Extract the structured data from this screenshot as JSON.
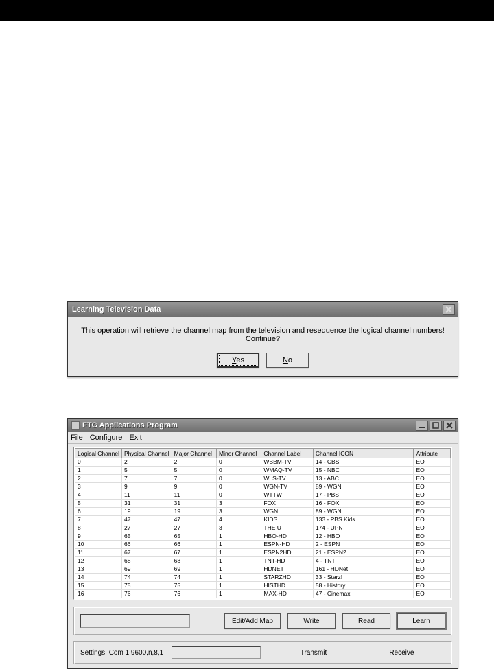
{
  "dialog": {
    "title": "Learning Television Data",
    "message": "This operation will retrieve the channel map from the television and resequence the logical channel numbers! Continue?",
    "yes": "Yes",
    "no": "No"
  },
  "mainWindow": {
    "title": "FTG Applications Program",
    "menu": {
      "file": "File",
      "configure": "Configure",
      "exit": "Exit"
    },
    "columns": {
      "logical": "Logical Channel",
      "physical": "Physical Channel",
      "major": "Major Channel",
      "minor": "Minor Channel",
      "label": "Channel Label",
      "icon": "Channel ICON",
      "attr": "Attribute"
    },
    "rows": [
      {
        "logical": "0",
        "physical": "2",
        "major": "2",
        "minor": "0",
        "label": "WBBM-TV",
        "icon": "14 - CBS",
        "attr": "EO"
      },
      {
        "logical": "1",
        "physical": "5",
        "major": "5",
        "minor": "0",
        "label": "WMAQ-TV",
        "icon": "15 - NBC",
        "attr": "EO"
      },
      {
        "logical": "2",
        "physical": "7",
        "major": "7",
        "minor": "0",
        "label": "WLS-TV",
        "icon": "13 - ABC",
        "attr": "EO"
      },
      {
        "logical": "3",
        "physical": "9",
        "major": "9",
        "minor": "0",
        "label": "WGN-TV",
        "icon": "89 - WGN",
        "attr": "EO"
      },
      {
        "logical": "4",
        "physical": "11",
        "major": "11",
        "minor": "0",
        "label": "WTTW",
        "icon": "17 - PBS",
        "attr": "EO"
      },
      {
        "logical": "5",
        "physical": "31",
        "major": "31",
        "minor": "3",
        "label": "FOX",
        "icon": "16 - FOX",
        "attr": "EO"
      },
      {
        "logical": "6",
        "physical": "19",
        "major": "19",
        "minor": "3",
        "label": "WGN",
        "icon": "89 - WGN",
        "attr": "EO"
      },
      {
        "logical": "7",
        "physical": "47",
        "major": "47",
        "minor": "4",
        "label": "KIDS",
        "icon": "133 - PBS Kids",
        "attr": "EO"
      },
      {
        "logical": "8",
        "physical": "27",
        "major": "27",
        "minor": "3",
        "label": "THE U",
        "icon": "174 - UPN",
        "attr": "EO"
      },
      {
        "logical": "9",
        "physical": "65",
        "major": "65",
        "minor": "1",
        "label": "HBO-HD",
        "icon": "12 - HBO",
        "attr": "EO"
      },
      {
        "logical": "10",
        "physical": "66",
        "major": "66",
        "minor": "1",
        "label": "ESPN-HD",
        "icon": "2 - ESPN",
        "attr": "EO"
      },
      {
        "logical": "11",
        "physical": "67",
        "major": "67",
        "minor": "1",
        "label": "ESPN2HD",
        "icon": "21 - ESPN2",
        "attr": "EO"
      },
      {
        "logical": "12",
        "physical": "68",
        "major": "68",
        "minor": "1",
        "label": "TNT-HD",
        "icon": "4 - TNT",
        "attr": "EO"
      },
      {
        "logical": "13",
        "physical": "69",
        "major": "69",
        "minor": "1",
        "label": "HDNET",
        "icon": "161 - HDNet",
        "attr": "EO"
      },
      {
        "logical": "14",
        "physical": "74",
        "major": "74",
        "minor": "1",
        "label": "STARZHD",
        "icon": "33 - Starz!",
        "attr": "EO"
      },
      {
        "logical": "15",
        "physical": "75",
        "major": "75",
        "minor": "1",
        "label": "HISTHD",
        "icon": "58 - History",
        "attr": "EO"
      },
      {
        "logical": "16",
        "physical": "76",
        "major": "76",
        "minor": "1",
        "label": "MAX-HD",
        "icon": "47 - Cinemax",
        "attr": "EO"
      }
    ],
    "buttons": {
      "editAdd": "Edit/Add Map",
      "write": "Write",
      "read": "Read",
      "learn": "Learn"
    },
    "status": {
      "settings": "Settings: Com 1 9600,n,8,1",
      "transmit": "Transmit",
      "receive": "Receive"
    }
  }
}
